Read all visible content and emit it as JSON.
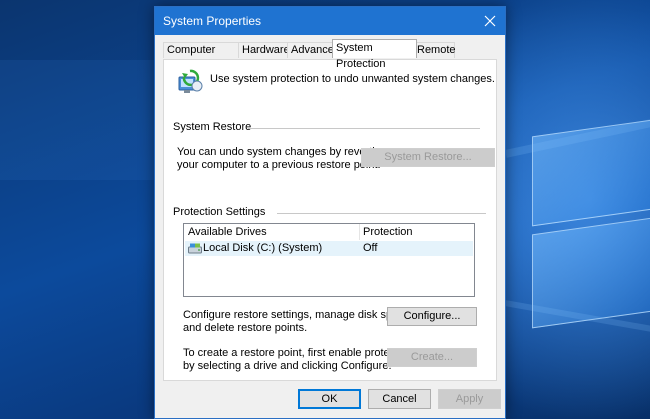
{
  "window": {
    "title": "System Properties"
  },
  "tabs": [
    {
      "label": "Computer Name"
    },
    {
      "label": "Hardware"
    },
    {
      "label": "Advanced"
    },
    {
      "label": "System Protection"
    },
    {
      "label": "Remote"
    }
  ],
  "active_tab": "System Protection",
  "intro": {
    "icon": "system-protection-icon",
    "text": "Use system protection to undo unwanted system changes."
  },
  "system_restore": {
    "group_label": "System Restore",
    "description_line1": "You can undo system changes by reverting",
    "description_line2": "your computer to a previous restore point.",
    "button_label": "System Restore...",
    "button_enabled": false
  },
  "protection_settings": {
    "group_label": "Protection Settings",
    "columns": [
      "Available Drives",
      "Protection"
    ],
    "drives": [
      {
        "icon": "local-disk-icon",
        "name": "Local Disk (C:) (System)",
        "protection": "Off",
        "selected": true
      }
    ],
    "configure_text_line1": "Configure restore settings, manage disk space,",
    "configure_text_line2": "and delete restore points.",
    "configure_button": "Configure...",
    "create_text_line1": "To create a restore point, first enable protection",
    "create_text_line2": "by selecting a drive and clicking Configure.",
    "create_button": "Create...",
    "create_enabled": false
  },
  "footer": {
    "ok": "OK",
    "cancel": "Cancel",
    "apply": "Apply",
    "apply_enabled": false
  },
  "colors": {
    "titlebar": "#1f73d1",
    "dialog_bg": "#f0f0f0",
    "default_button_border": "#0078d7",
    "selected_row": "#e5f3fb"
  }
}
